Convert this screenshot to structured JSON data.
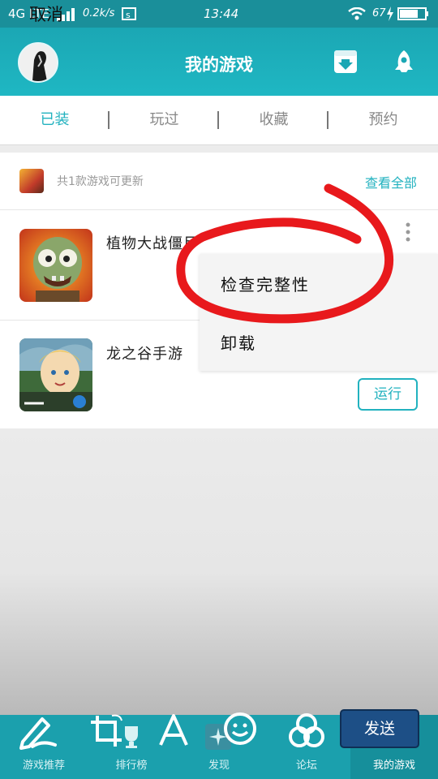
{
  "status_bar": {
    "network": "4G LTE",
    "speed": "0.2k/s",
    "time": "13:44",
    "battery": "67"
  },
  "header": {
    "cancel_label": "取消",
    "title": "我的游戏"
  },
  "tabs": [
    {
      "label": "已装",
      "active": true
    },
    {
      "label": "玩过",
      "active": false
    },
    {
      "label": "收藏",
      "active": false
    },
    {
      "label": "预约",
      "active": false
    }
  ],
  "updates": {
    "text": "共1款游戏可更新",
    "view_all": "查看全部"
  },
  "games": [
    {
      "name": "植物大战僵尸"
    },
    {
      "name": "龙之谷手游",
      "action": "运行"
    }
  ],
  "context_menu": {
    "items": [
      "检查完整性",
      "卸载"
    ]
  },
  "bottom_nav": [
    {
      "label": "游戏推荐",
      "icon": "gamepad-icon"
    },
    {
      "label": "排行榜",
      "icon": "trophy-icon"
    },
    {
      "label": "发现",
      "icon": "sparkle-icon"
    },
    {
      "label": "论坛",
      "icon": "forum-icon"
    },
    {
      "label": "我的游戏",
      "icon": "my-games-icon",
      "active": true
    }
  ],
  "annotation_toolbar": {
    "send_label": "发送",
    "tools": [
      "pen-icon",
      "crop-icon",
      "text-icon",
      "emoji-icon",
      "mosaic-icon"
    ]
  },
  "colors": {
    "accent": "#22b2bf",
    "header": "#1ba7b4",
    "annotation": "#e8191c",
    "send_button": "#1d4f86"
  }
}
